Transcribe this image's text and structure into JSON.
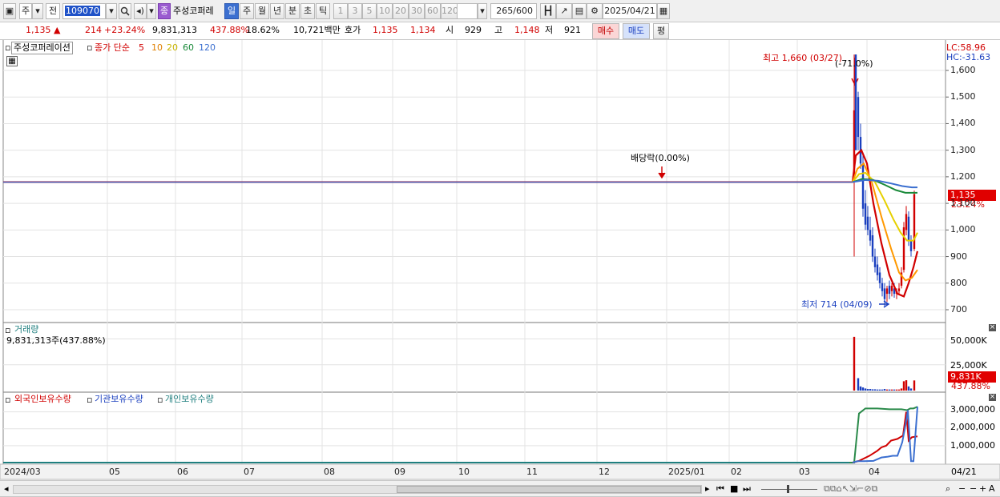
{
  "toolbar": {
    "market_label": "주",
    "all_label": "전",
    "code": "109070",
    "stock_name": "주성코퍼레",
    "period_tabs": [
      {
        "label": "일",
        "active": true
      },
      {
        "label": "주"
      },
      {
        "label": "월"
      },
      {
        "label": "년"
      },
      {
        "label": "분"
      },
      {
        "label": "초"
      },
      {
        "label": "틱"
      }
    ],
    "interval_buttons": [
      "1",
      "3",
      "5",
      "10",
      "20",
      "30",
      "60",
      "120"
    ],
    "bar_count": "265",
    "bar_max": "/600",
    "date": "2025/04/21",
    "badge": "종"
  },
  "quote": {
    "price": "1,135 ▲",
    "change": "214",
    "change_pct": "+23.24%",
    "volume": "9,831,313",
    "volume_pct": "437.88%",
    "turnover_pct": "18.62%",
    "amount": "10,721백만",
    "hoga_label": "호가",
    "ask": "1,135",
    "bid": "1,134",
    "open_label": "시",
    "open": "929",
    "high_label": "고",
    "high": "1,148",
    "low_label": "저",
    "low": "921",
    "buy_label": "매수",
    "sell_label": "매도",
    "eval_label": "평"
  },
  "price_panel": {
    "stock_title": "주성코퍼레이션",
    "indicator_label": "종가 단순",
    "ma_periods": [
      "5",
      "10",
      "20",
      "60",
      "120"
    ],
    "lc": "LC:58.96",
    "hc": "HC:-31.63",
    "high_annotation": "최고 1,660 (03/27)",
    "high_pct": "(-71.0%)",
    "low_annotation": "최저 714 (04/09)",
    "dividend_annotation": "배당락(0.00%)",
    "current_price_tag": "1,135",
    "current_pct_tag": "23.24%",
    "y_ticks": [
      "1,600",
      "1,500",
      "1,400",
      "1,300",
      "1,200",
      "1,100",
      "1,000",
      "900",
      "800",
      "700"
    ]
  },
  "volume_panel": {
    "title": "거래량",
    "value_text": "9,831,313주(437.88%)",
    "y_ticks": [
      "50,000K",
      "25,000K"
    ],
    "current_tag": "9,831K",
    "current_pct": "437.88%"
  },
  "holdings_panel": {
    "foreign_label": "외국인보유수량",
    "institution_label": "기관보유수량",
    "individual_label": "개인보유수량",
    "y_ticks": [
      "3,000,000",
      "2,000,000",
      "1,000,000"
    ]
  },
  "x_axis": {
    "labels": [
      "2024/03",
      "05",
      "06",
      "07",
      "08",
      "09",
      "10",
      "11",
      "12",
      "2025/01",
      "02",
      "03",
      "04"
    ],
    "right_label": "04/21"
  },
  "colors": {
    "up": "#d10000",
    "down": "#1a3fbf",
    "ma5": "#d10000",
    "ma10": "#ff9900",
    "ma20": "#e6d000",
    "ma60": "#1a8a3a",
    "ma120": "#3b6fd0"
  },
  "chart_data": {
    "type": "line",
    "x_range": [
      "2024/03",
      "2025/04/21"
    ],
    "y_range": [
      660,
      1700
    ],
    "pre_listing_level": 1180,
    "closes_recent": [
      {
        "date": "03/27",
        "high": 1660,
        "close": 1530
      },
      {
        "date": "04/09",
        "low": 714,
        "close": 740
      },
      {
        "date": "04/21",
        "open": 929,
        "high": 1148,
        "low": 921,
        "close": 1135
      }
    ],
    "moving_averages": [
      "5",
      "10",
      "20",
      "60",
      "120"
    ]
  }
}
